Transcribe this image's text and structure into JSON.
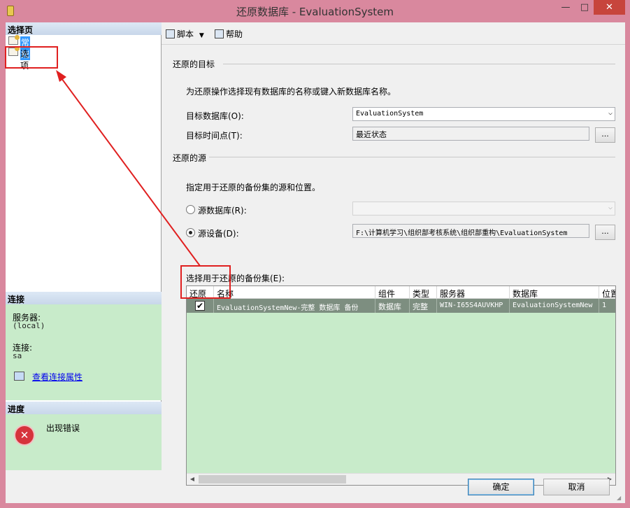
{
  "window": {
    "title": "还原数据库 - EvaluationSystem",
    "minimize": "—",
    "maximize": "□",
    "close": "✕"
  },
  "left_panel": {
    "select_page_header": "选择页",
    "nav_items": [
      {
        "label": "常规",
        "icon": "page-icon",
        "selected": true
      },
      {
        "label": "选项",
        "icon": "page-icon",
        "selected": false
      }
    ],
    "connection_header": "连接",
    "server_label": "服务器:",
    "server_value": "(local)",
    "connection_label": "连接:",
    "connection_value": "sa",
    "view_connection_link": "查看连接属性",
    "progress_header": "进度",
    "progress_status": "出现错误"
  },
  "toolbar": {
    "script_label": "脚本",
    "help_label": "帮助"
  },
  "restore_target": {
    "section_title": "还原的目标",
    "description": "为还原操作选择现有数据库的名称或键入新数据库名称。",
    "target_db_label": "目标数据库(O):",
    "target_db_value": "EvaluationSystem",
    "target_time_label": "目标时间点(T):",
    "target_time_value": "最近状态",
    "ellipsis": "..."
  },
  "restore_source": {
    "section_title": "还原的源",
    "description": "指定用于还原的备份集的源和位置。",
    "source_db_label": "源数据库(R):",
    "source_db_value": "",
    "source_device_label": "源设备(D):",
    "source_device_value": "F:\\计算机学习\\组织部考核系统\\组织部重构\\EvaluationSystem",
    "selected_option": "source_device",
    "ellipsis": "..."
  },
  "backup_sets": {
    "label": "选择用于还原的备份集(E):",
    "columns": [
      "还原",
      "名称",
      "组件",
      "类型",
      "服务器",
      "数据库",
      "位置"
    ],
    "rows": [
      {
        "restore": true,
        "check": "✔",
        "name": "EvaluationSystemNew-完整 数据库 备份",
        "component": "数据库",
        "type": "完整",
        "server": "WIN-I65S4AUVKHP",
        "database": "EvaluationSystemNew",
        "position": "1"
      }
    ]
  },
  "buttons": {
    "ok": "确定",
    "cancel": "取消"
  },
  "colors": {
    "title_bar": "#d9889e",
    "selected_row": "#7d8e80",
    "panel_green": "#c8ebca",
    "annotation_red": "#e02020"
  }
}
